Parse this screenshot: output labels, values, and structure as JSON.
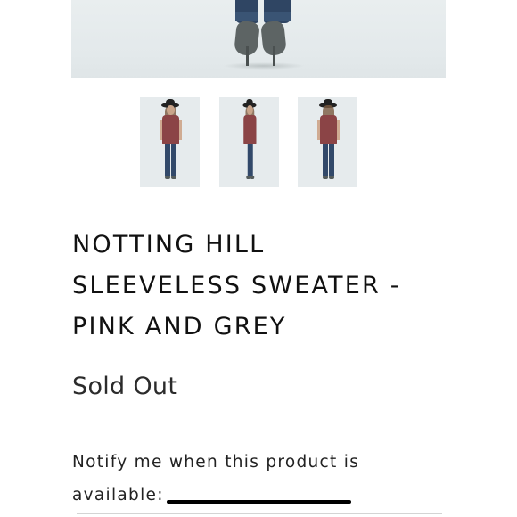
{
  "product": {
    "title_lines": [
      "NOTTING HILL",
      "SLEEVELESS SWEATER -",
      "PINK AND GREY"
    ],
    "status": "Sold Out"
  },
  "gallery": {
    "thumbnails": [
      {
        "view": "front"
      },
      {
        "view": "side"
      },
      {
        "view": "back"
      }
    ]
  },
  "notify": {
    "line1": "Notify me when this product is",
    "line2": "available:"
  },
  "colors": {
    "sweater": "#8b4446",
    "jeans": "#2f4563",
    "background": "#ffffff"
  }
}
